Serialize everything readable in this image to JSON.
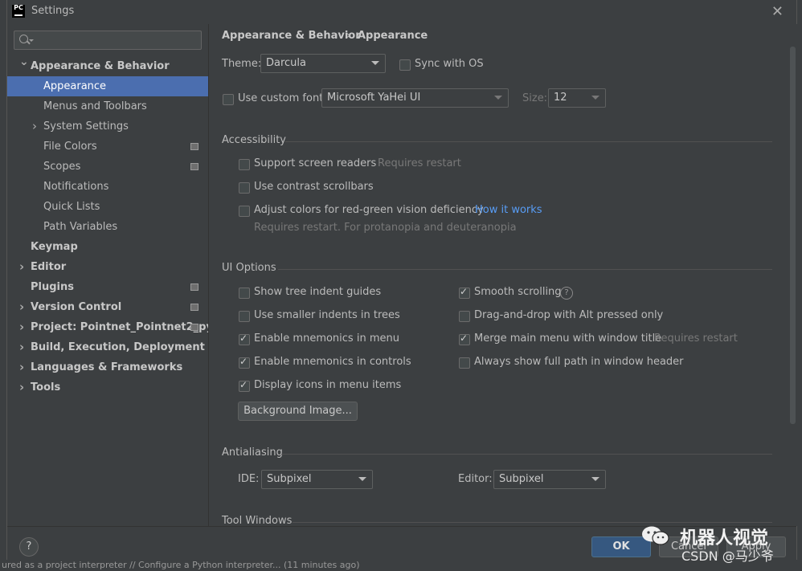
{
  "window": {
    "title": "Settings"
  },
  "background": {
    "status_text": "ured as a project interpreter // Configure a Python interpreter... (11 minutes ago)"
  },
  "sidebar": {
    "search": {
      "placeholder": "",
      "value": ""
    },
    "items": [
      {
        "label": "Appearance & Behavior",
        "level": 0,
        "expanded": true,
        "bold": true
      },
      {
        "label": "Appearance",
        "level": 1,
        "selected": true
      },
      {
        "label": "Menus and Toolbars",
        "level": 1
      },
      {
        "label": "System Settings",
        "level": 1,
        "collapsed": true
      },
      {
        "label": "File Colors",
        "level": 1,
        "project": true
      },
      {
        "label": "Scopes",
        "level": 1,
        "project": true
      },
      {
        "label": "Notifications",
        "level": 1
      },
      {
        "label": "Quick Lists",
        "level": 1
      },
      {
        "label": "Path Variables",
        "level": 1
      },
      {
        "label": "Keymap",
        "level": 0,
        "bold": true
      },
      {
        "label": "Editor",
        "level": 0,
        "bold": true,
        "collapsed": true
      },
      {
        "label": "Plugins",
        "level": 0,
        "bold": true,
        "project": true
      },
      {
        "label": "Version Control",
        "level": 0,
        "bold": true,
        "collapsed": true,
        "project": true
      },
      {
        "label": "Project: Pointnet_Pointnet2_py...",
        "level": 0,
        "bold": true,
        "collapsed": true,
        "project": true
      },
      {
        "label": "Build, Execution, Deployment",
        "level": 0,
        "bold": true,
        "collapsed": true
      },
      {
        "label": "Languages & Frameworks",
        "level": 0,
        "bold": true,
        "collapsed": true
      },
      {
        "label": "Tools",
        "level": 0,
        "bold": true,
        "collapsed": true
      }
    ]
  },
  "breadcrumb": {
    "parent": "Appearance & Behavior",
    "separator": "›",
    "current": "Appearance"
  },
  "theme": {
    "label": "Theme:",
    "value": "Darcula",
    "sync_label": "Sync with OS",
    "sync_checked": false
  },
  "font": {
    "custom_label": "Use custom font:",
    "custom_checked": false,
    "value": "Microsoft YaHei UI",
    "size_label": "Size:",
    "size_value": "12"
  },
  "accessibility": {
    "title": "Accessibility",
    "screen_readers": {
      "label": "Support screen readers",
      "note": "Requires restart",
      "checked": false
    },
    "contrast_scrollbars": {
      "label": "Use contrast scrollbars",
      "checked": false
    },
    "color_deficiency": {
      "label": "Adjust colors for red-green vision deficiency",
      "link": "How it works",
      "note": "Requires restart. For protanopia and deuteranopia",
      "checked": false
    }
  },
  "ui_options": {
    "title": "UI Options",
    "left": [
      {
        "label": "Show tree indent guides",
        "checked": false
      },
      {
        "label": "Use smaller indents in trees",
        "checked": false
      },
      {
        "label": "Enable mnemonics in menu",
        "checked": true
      },
      {
        "label": "Enable mnemonics in controls",
        "checked": true
      },
      {
        "label": "Display icons in menu items",
        "checked": true
      }
    ],
    "right": [
      {
        "label": "Smooth scrolling",
        "checked": true,
        "help": "?"
      },
      {
        "label": "Drag-and-drop with Alt pressed only",
        "checked": false
      },
      {
        "label": "Merge main menu with window title",
        "checked": true,
        "note": "Requires restart"
      },
      {
        "label": "Always show full path in window header",
        "checked": false
      }
    ],
    "background_button": "Background Image..."
  },
  "antialiasing": {
    "title": "Antialiasing",
    "ide_label": "IDE:",
    "ide_value": "Subpixel",
    "editor_label": "Editor:",
    "editor_value": "Subpixel"
  },
  "tool_windows": {
    "title": "Tool Windows"
  },
  "footer": {
    "help": "?",
    "ok": "OK",
    "cancel": "Cancel",
    "apply": "Apply"
  },
  "watermark": {
    "name": "机器人视觉",
    "sub": "CSDN @马少爷"
  }
}
